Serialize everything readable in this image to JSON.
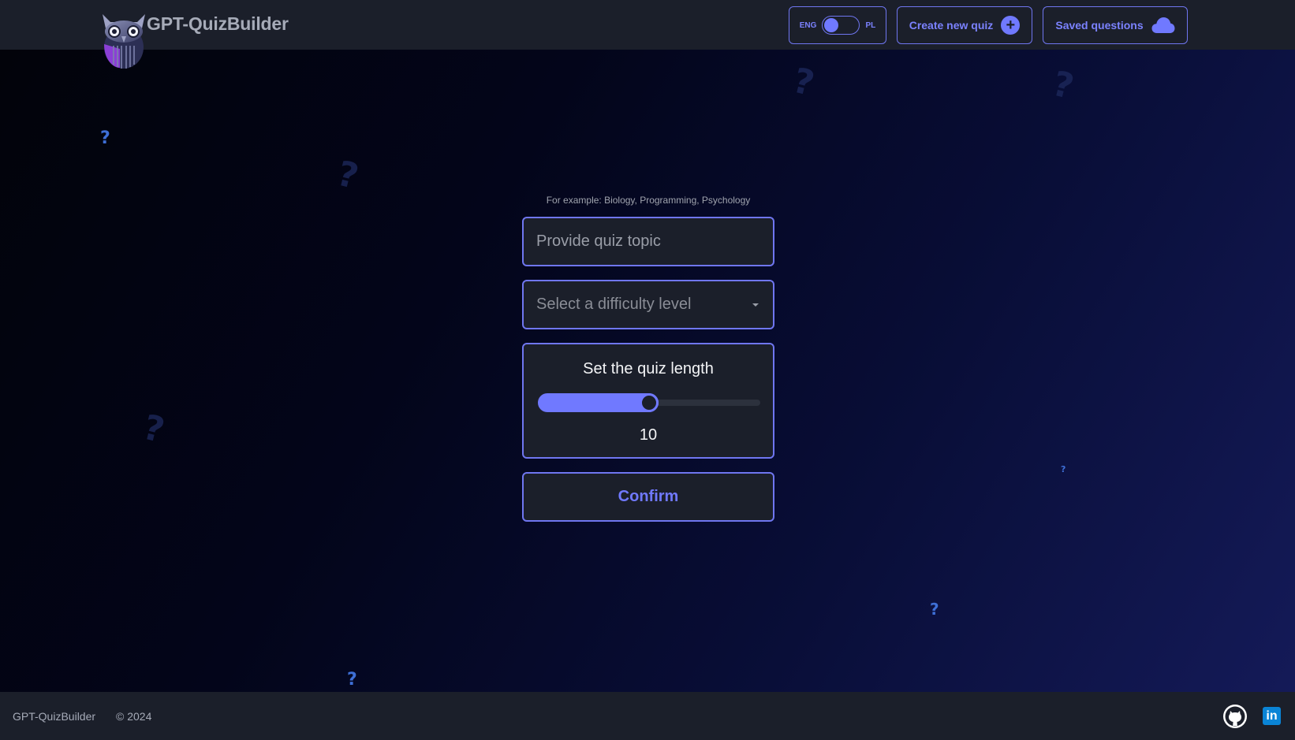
{
  "header": {
    "title": "GPT-QuizBuilder",
    "lang_toggle": {
      "left_label": "ENG",
      "right_label": "PL",
      "selected": "ENG"
    },
    "create_label": "Create new quiz",
    "saved_label": "Saved questions"
  },
  "form": {
    "hint": "For example: Biology, Programming, Psychology",
    "topic_placeholder": "Provide quiz topic",
    "topic_value": "",
    "difficulty_placeholder": "Select a difficulty level",
    "length_title": "Set the quiz length",
    "length_value": "10",
    "length_fraction": 0.5,
    "confirm_label": "Confirm"
  },
  "footer": {
    "brand": "GPT-QuizBuilder",
    "copyright": "© 2024"
  },
  "colors": {
    "accent": "#7079ff",
    "surface": "#1b1f2a"
  }
}
